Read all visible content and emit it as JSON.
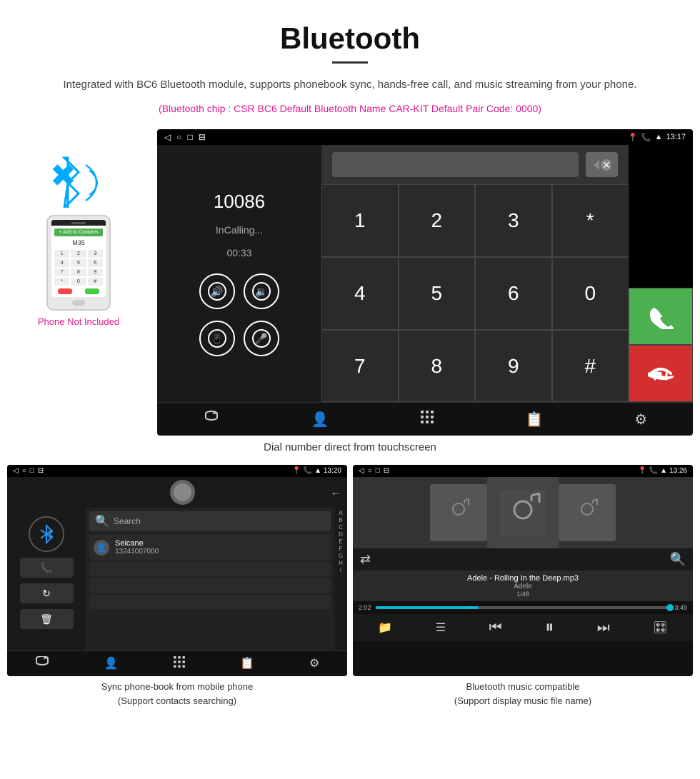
{
  "page": {
    "title": "Bluetooth",
    "divider": true,
    "description": "Integrated with BC6 Bluetooth module, supports phonebook sync, hands-free call, and music streaming from your phone.",
    "specs": "(Bluetooth chip : CSR BC6    Default Bluetooth Name CAR-KIT    Default Pair Code: 0000)",
    "phone_not_included": "Phone Not Included"
  },
  "dial_screen": {
    "status_left": [
      "◁",
      "○",
      "□",
      "⊟"
    ],
    "status_right": [
      "📍",
      "📞",
      "▲",
      "13:17"
    ],
    "call_number": "10086",
    "call_status": "InCalling...",
    "call_timer": "00:33",
    "controls": [
      "🔊+",
      "🔉",
      "📱→",
      "🎤"
    ],
    "keys": [
      "1",
      "2",
      "3",
      "*",
      "4",
      "5",
      "6",
      "0",
      "7",
      "8",
      "9",
      "#"
    ],
    "green_icon": "📞",
    "red_icon": "📞",
    "nav_icons": [
      "📞",
      "👤",
      "⠿",
      "📋",
      "⚙"
    ]
  },
  "dial_caption": "Dial number direct from touchscreen",
  "phonebook_screen": {
    "time": "13:20",
    "status_right": "📍📞▲",
    "status_left": [
      "◁",
      "○",
      "□",
      "⊟"
    ],
    "search_placeholder": "Search",
    "contact_name": "Seicane",
    "contact_number": "13241007000",
    "alphabet": [
      "A",
      "B",
      "C",
      "D",
      "E",
      "F",
      "G",
      "H",
      "I"
    ],
    "nav_icons": [
      "📞",
      "👤",
      "⠿",
      "📋",
      "⚙"
    ]
  },
  "phonebook_caption": "Sync phone-book from mobile phone\n(Support contacts searching)",
  "music_screen": {
    "time": "13:26",
    "status_right": "📍📞▲",
    "title": "Adele - Rolling In the Deep.mp3",
    "artist": "Adele",
    "counter": "1/48",
    "time_current": "2:02",
    "time_total": "3:49",
    "progress_pct": 35,
    "nav_icons": [
      "📁",
      "☰",
      "⏮",
      "⏸",
      "⏭",
      "🎛"
    ],
    "controls": [
      "🔀",
      "🔍"
    ]
  },
  "music_caption": "Bluetooth music compatible\n(Support display music file name)"
}
